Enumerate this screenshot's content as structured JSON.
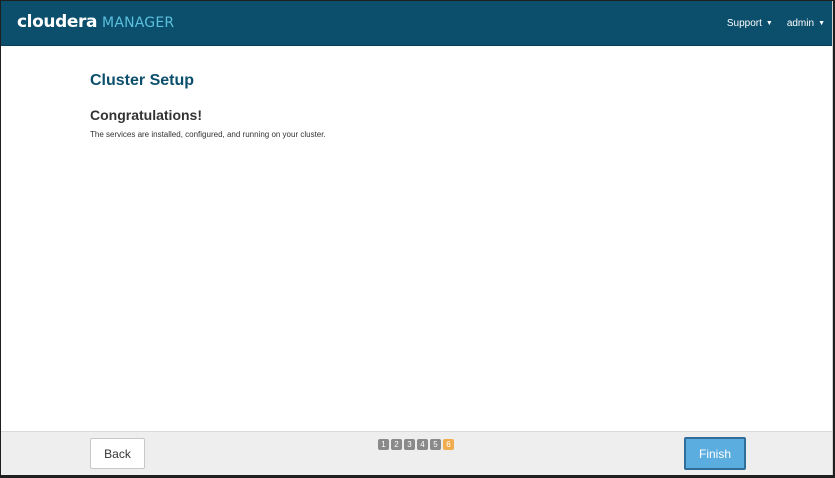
{
  "header": {
    "brand_main": "cloudera",
    "brand_sub": "MANAGER",
    "nav": [
      {
        "label": "Support"
      },
      {
        "label": "admin"
      }
    ]
  },
  "main": {
    "title": "Cluster Setup",
    "subtitle": "Congratulations!",
    "message": "The services are installed, configured, and running on your cluster."
  },
  "footer": {
    "back_label": "Back",
    "finish_label": "Finish",
    "steps": [
      "1",
      "2",
      "3",
      "4",
      "5",
      "6"
    ],
    "active_step": 6
  },
  "colors": {
    "header_bg": "#0b4f6c",
    "brand_accent": "#5bc0de",
    "title_color": "#0b4f6c",
    "active_step": "#f0ad4e",
    "finish_button": "#5bade0"
  },
  "icons": {
    "nav_caret": "caret-down-icon"
  }
}
